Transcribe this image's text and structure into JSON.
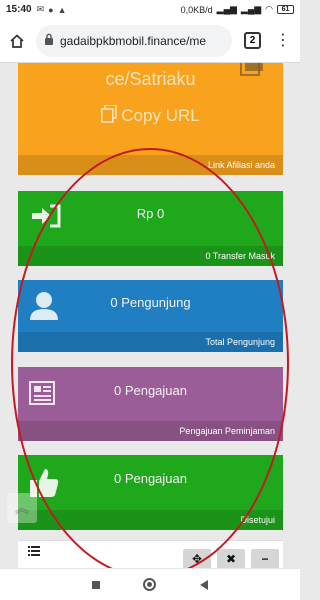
{
  "status_bar": {
    "time": "15:40",
    "network_speed": "0,0KB/d",
    "battery": "61"
  },
  "browser": {
    "url": "gadaibpkbmobil.finance/me",
    "tab_count": "2"
  },
  "cards": {
    "referral": {
      "ref_text": "ce/Satriaku",
      "copy_label": "Copy URL",
      "footer": "Link Afiliasi anda"
    },
    "transfer": {
      "value": "Rp 0",
      "footer": "0 Transfer Masuk"
    },
    "visitors": {
      "value": "0 Pengunjung",
      "footer": "Total Pengunjung"
    },
    "applications": {
      "value": "0 Pengajuan",
      "footer": "Pengajuan Peminjaman"
    },
    "approved": {
      "value": "0 Pengajuan",
      "footer": "Disetujui"
    }
  },
  "colors": {
    "orange": "#f8a21e",
    "green": "#1fa81c",
    "blue": "#1f7fc2",
    "purple": "#9a5d97",
    "annotation": "#c31a22"
  },
  "icons": {
    "transfer": "sign-in-icon",
    "visitors": "user-icon",
    "applications": "newspaper-icon",
    "approved": "thumbs-up-icon"
  },
  "toolbar": {
    "move_label": "✥",
    "close_label": "✖",
    "minimize_label": "−"
  }
}
